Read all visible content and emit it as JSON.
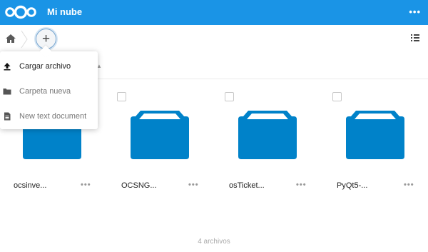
{
  "header": {
    "app_title": "Mi nube",
    "more_label": "•••",
    "logo_icon": "nextcloud-logo",
    "accent_color": "#1a94e6"
  },
  "controls": {
    "home_icon": "home-icon",
    "add_label": "+",
    "view_icon": "list-view-icon"
  },
  "new_menu": {
    "items": [
      {
        "label": "Cargar archivo",
        "icon": "upload-icon"
      },
      {
        "label": "Carpeta nueva",
        "icon": "folder-icon"
      },
      {
        "label": "New text document",
        "icon": "text-document-icon"
      }
    ]
  },
  "files": [
    {
      "name": "ocsinve...",
      "more": "•••"
    },
    {
      "name": "OCSNG...",
      "more": "•••"
    },
    {
      "name": "osTicket...",
      "more": "•••"
    },
    {
      "name": "PyQt5-...",
      "more": "•••"
    }
  ],
  "folder_color": "#0082c9",
  "summary": "4 archivos"
}
